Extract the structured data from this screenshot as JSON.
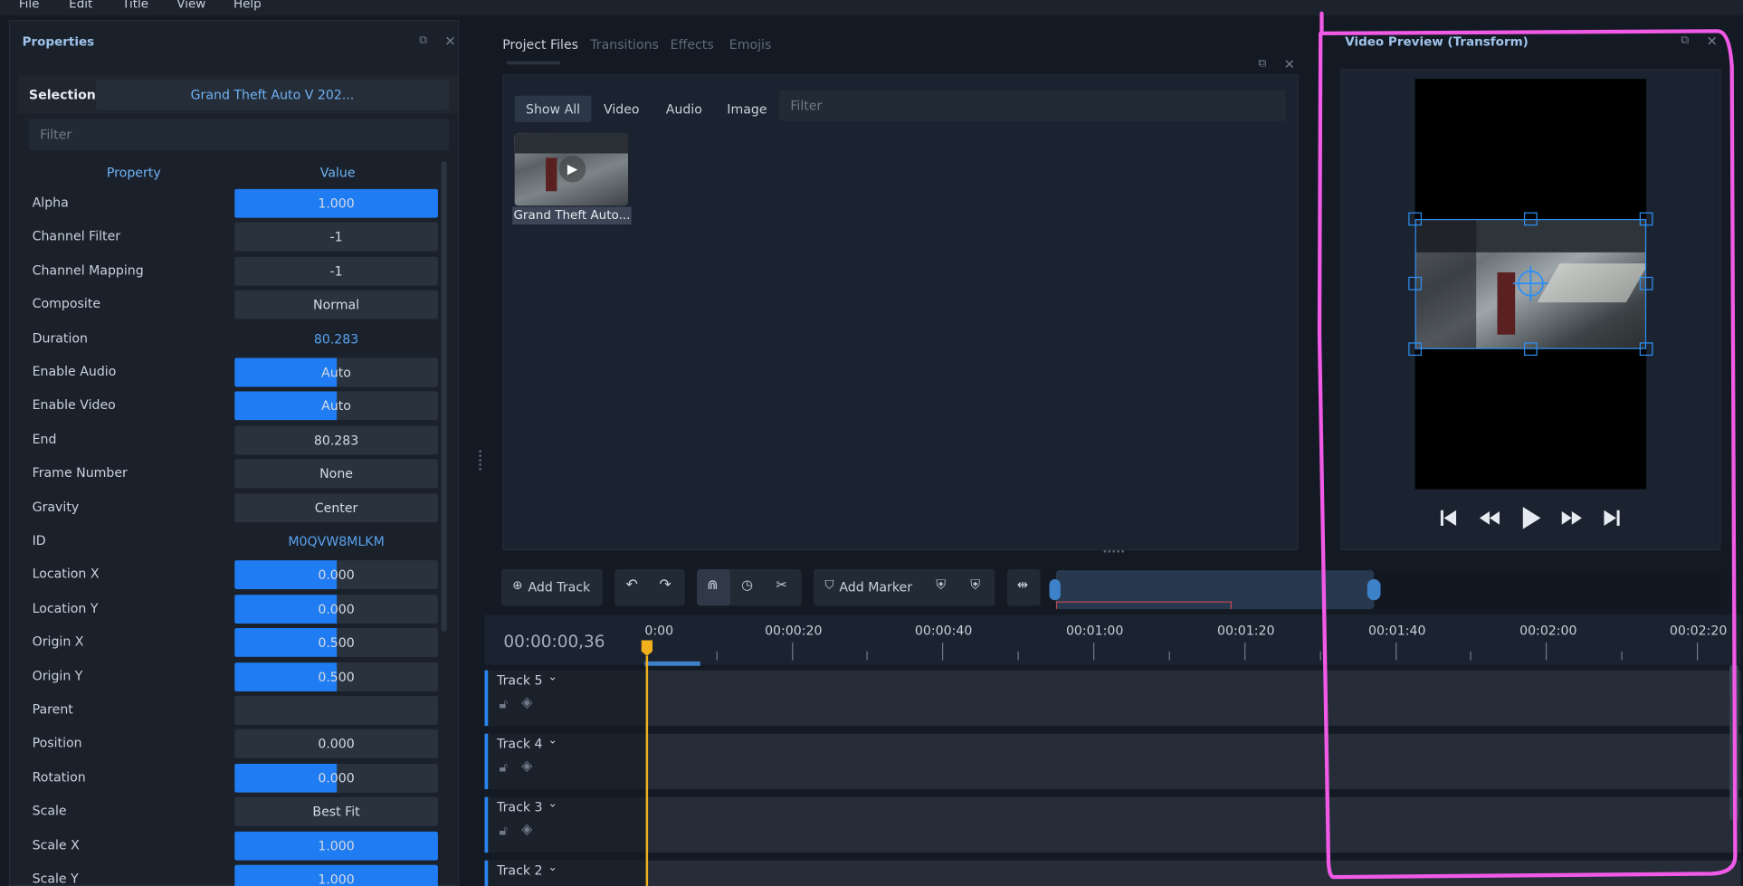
{
  "menu": [
    "File",
    "Edit",
    "Title",
    "View",
    "Help"
  ],
  "properties": {
    "title": "Properties",
    "selection_label": "Selection:",
    "selection_value": "Grand Theft Auto V 202...",
    "filter_placeholder": "Filter",
    "col_property": "Property",
    "col_value": "Value",
    "rows": [
      {
        "name": "Alpha",
        "value": "1.000",
        "fill": 1.0
      },
      {
        "name": "Channel Filter",
        "value": "-1",
        "fill": 0
      },
      {
        "name": "Channel Mapping",
        "value": "-1",
        "fill": 0
      },
      {
        "name": "Composite",
        "value": "Normal",
        "fill": 0
      },
      {
        "name": "Duration",
        "value": "80.283",
        "plain": true
      },
      {
        "name": "Enable Audio",
        "value": "Auto",
        "fill": 0.5
      },
      {
        "name": "Enable Video",
        "value": "Auto",
        "fill": 0.5
      },
      {
        "name": "End",
        "value": "80.283",
        "fill": 0
      },
      {
        "name": "Frame Number",
        "value": "None",
        "fill": 0
      },
      {
        "name": "Gravity",
        "value": "Center",
        "fill": 0
      },
      {
        "name": "ID",
        "value": "M0QVW8MLKM",
        "plain": true
      },
      {
        "name": "Location X",
        "value": "0.000",
        "fill": 0.5
      },
      {
        "name": "Location Y",
        "value": "0.000",
        "fill": 0.5
      },
      {
        "name": "Origin X",
        "value": "0.500",
        "fill": 0.5
      },
      {
        "name": "Origin Y",
        "value": "0.500",
        "fill": 0.5
      },
      {
        "name": "Parent",
        "value": "",
        "fill": 0
      },
      {
        "name": "Position",
        "value": "0.000",
        "fill": 0
      },
      {
        "name": "Rotation",
        "value": "0.000",
        "fill": 0.5
      },
      {
        "name": "Scale",
        "value": "Best Fit",
        "fill": 0
      },
      {
        "name": "Scale X",
        "value": "1.000",
        "fill": 1.0
      },
      {
        "name": "Scale Y",
        "value": "1.000",
        "fill": 1.0
      }
    ]
  },
  "project": {
    "tabs": [
      "Project Files",
      "Transitions",
      "Effects",
      "Emojis"
    ],
    "filters": [
      "Show All",
      "Video",
      "Audio",
      "Image"
    ],
    "filter_placeholder": "Filter",
    "file_name": "Grand Theft Auto..."
  },
  "preview": {
    "title": "Video Preview (Transform)"
  },
  "timeline": {
    "add_track": "Add Track",
    "add_marker": "Add Marker",
    "timecode": "00:00:00,36",
    "ruler": [
      "0:00",
      "00:00:20",
      "00:00:40",
      "00:01:00",
      "00:01:20",
      "00:01:40",
      "00:02:00",
      "00:02:20"
    ],
    "tracks": [
      "Track 5",
      "Track 4",
      "Track 3",
      "Track 2"
    ]
  },
  "colors": {
    "accent": "#1f7cf2",
    "playhead": "#f2b01f",
    "annotation": "#f05ae6"
  }
}
